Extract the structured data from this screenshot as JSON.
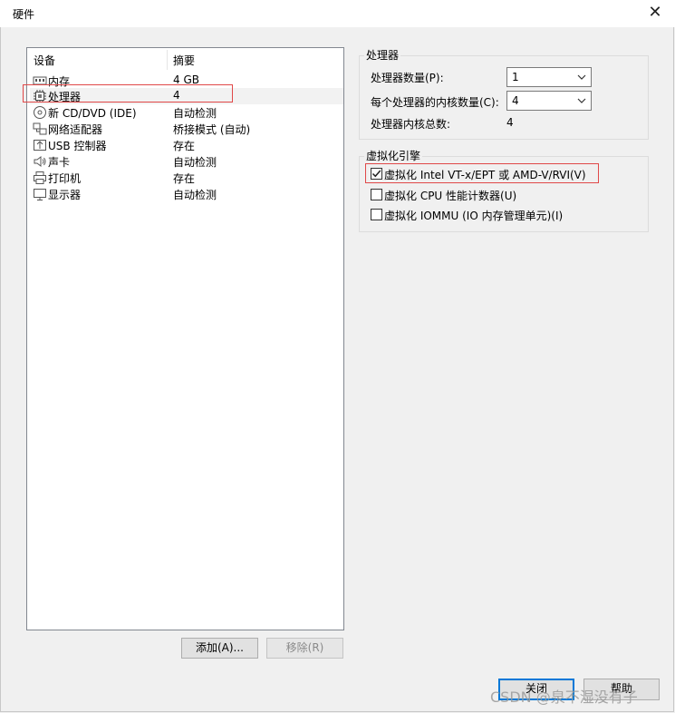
{
  "window": {
    "title": "硬件",
    "close_glyph": "✕"
  },
  "device_list": {
    "columns": {
      "device": "设备",
      "summary": "摘要"
    },
    "items": [
      {
        "icon": "memory-icon",
        "name": "内存",
        "summary": "4 GB"
      },
      {
        "icon": "processor-icon",
        "name": "处理器",
        "summary": "4"
      },
      {
        "icon": "cd-dvd-icon",
        "name": "新 CD/DVD (IDE)",
        "summary": "自动检测"
      },
      {
        "icon": "network-adapter-icon",
        "name": "网络适配器",
        "summary": "桥接模式 (自动)"
      },
      {
        "icon": "usb-icon",
        "name": "USB 控制器",
        "summary": "存在"
      },
      {
        "icon": "sound-icon",
        "name": "声卡",
        "summary": "自动检测"
      },
      {
        "icon": "printer-icon",
        "name": "打印机",
        "summary": "存在"
      },
      {
        "icon": "display-icon",
        "name": "显示器",
        "summary": "自动检测"
      }
    ],
    "selected": "处理器",
    "add_button": "添加(A)...",
    "remove_button": "移除(R)"
  },
  "processors": {
    "group_title": "处理器",
    "count_label": "处理器数量(P):",
    "count_value": "1",
    "cores_label": "每个处理器的内核数量(C):",
    "cores_value": "4",
    "total_label": "处理器内核总数:",
    "total_value": "4"
  },
  "virtualization": {
    "group_title": "虚拟化引擎",
    "options": [
      {
        "label": "虚拟化 Intel VT-x/EPT 或 AMD-V/RVI(V)",
        "checked": true
      },
      {
        "label": "虚拟化 CPU 性能计数器(U)",
        "checked": false
      },
      {
        "label": "虚拟化 IOMMU (IO 内存管理单元)(I)",
        "checked": false
      }
    ]
  },
  "footer": {
    "close_button": "关闭",
    "help_button": "帮助"
  },
  "watermark": "CSDN @泉不湿没有子",
  "colors": {
    "highlight_border": "#e04848",
    "default_button_border": "#0078d7"
  }
}
